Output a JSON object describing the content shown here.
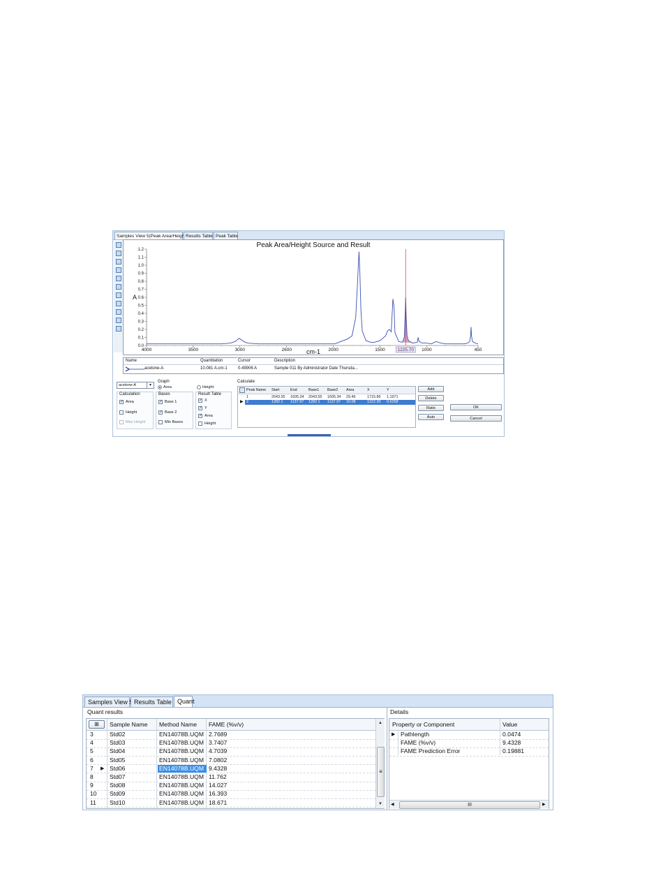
{
  "shot1": {
    "tabs": [
      {
        "label": "Samples View 5(Peak Area/Height)",
        "active": true
      },
      {
        "label": "Results Table",
        "active": false
      },
      {
        "label": "Peak Table",
        "active": false
      }
    ],
    "chart_data": {
      "type": "line",
      "title": "Peak Area/Height Source and Result",
      "xlabel": "cm-1",
      "ylabel": "A",
      "x_reversed": true,
      "xlim": [
        4000,
        450
      ],
      "ylim": [
        0,
        1.2
      ],
      "x_tick_labels": [
        "4000",
        "3500",
        "3000",
        "2600",
        "2000",
        "1500",
        "1000",
        "450"
      ],
      "x_ticks": [
        4000,
        3500,
        3000,
        2500,
        2000,
        1500,
        1000,
        450
      ],
      "y_ticks": [
        "0.0",
        "0.1",
        "0.2",
        "0.3",
        "0.4",
        "0.5",
        "0.6",
        "0.7",
        "0.8",
        "0.9",
        "1.0",
        "1.1",
        "1.2"
      ],
      "cursor_label": "1225.70",
      "cursor_x": 1225.7,
      "line_color": "#3a4fb3",
      "cursor_color": "#d62a2a",
      "fill_color": "#d9a5c2",
      "series": [
        {
          "x": [
            4000,
            3800,
            3600,
            3400,
            3200,
            3100,
            3050,
            3010,
            2960,
            2920,
            2800,
            2600,
            2400,
            2200,
            2100,
            2050,
            2020,
            1990,
            1960,
            1920,
            1850,
            1800,
            1760,
            1740,
            1725,
            1715,
            1705,
            1690,
            1650,
            1600,
            1560,
            1500,
            1440,
            1420,
            1400,
            1380,
            1362,
            1350,
            1340,
            1300,
            1260,
            1240,
            1232,
            1225,
            1220,
            1210,
            1195,
            1150,
            1100,
            1092,
            1080,
            1050,
            1000,
            950,
            900,
            850,
            800,
            720,
            640,
            600,
            560,
            540,
            530,
            525,
            520,
            510,
            480,
            450
          ],
          "y": [
            0.02,
            0.02,
            0.02,
            0.02,
            0.02,
            0.03,
            0.05,
            0.09,
            0.05,
            0.03,
            0.02,
            0.02,
            0.02,
            0.02,
            0.02,
            0.02,
            0.02,
            0.02,
            0.03,
            0.05,
            0.08,
            0.12,
            0.35,
            0.8,
            1.17,
            0.9,
            0.45,
            0.18,
            0.06,
            0.04,
            0.04,
            0.06,
            0.12,
            0.18,
            0.2,
            0.17,
            0.58,
            0.48,
            0.16,
            0.05,
            0.04,
            0.1,
            0.35,
            0.6,
            0.35,
            0.12,
            0.06,
            0.03,
            0.04,
            0.1,
            0.05,
            0.03,
            0.03,
            0.02,
            0.05,
            0.03,
            0.02,
            0.02,
            0.02,
            0.02,
            0.03,
            0.05,
            0.12,
            0.23,
            0.12,
            0.05,
            0.03,
            0.02
          ]
        }
      ]
    },
    "legend": {
      "headers": [
        "Name",
        "Quantitation",
        "Cursor",
        "Description"
      ],
      "row": {
        "name": "acetone-A",
        "quantitation": "10.081 A.cm-1",
        "cursor": "0.49906 A",
        "description": "Sample 011 By Administrator Date Thursda..."
      }
    },
    "controls": {
      "component_select": "acetone-A",
      "graph_label": "Graph",
      "graph_area": "Area",
      "graph_height": "Height",
      "calculation_label": "Calculation",
      "calc_area": "Area",
      "calc_height": "Height",
      "calc_max_height": "Max Height",
      "bases_label": "Bases",
      "base1": "Base 1",
      "base2": "Base 2",
      "min_bases": "Min Bases",
      "result_table_label": "Result Table",
      "rt_x": "X",
      "rt_y": "Y",
      "rt_area": "Area",
      "rt_height": "Height"
    },
    "calculate": {
      "label": "Calculate",
      "headers": [
        "Peak Name",
        "Start",
        "End",
        "Base1",
        "Base2",
        "Area",
        "X",
        "Y"
      ],
      "rows": [
        [
          "1",
          "2043.55",
          "1605.34",
          "2043.55",
          "1605.34",
          "29.46",
          "1715.86",
          "1.1971"
        ],
        [
          "2",
          "1282.1",
          "1137.97",
          "1282.1",
          "1137.97",
          "10.08",
          "1222.30",
          "0.6258"
        ]
      ],
      "selected_row": 1
    },
    "buttons": {
      "add": "Add",
      "delete": "Delete",
      "ratio": "Ratio",
      "auto": "Auto",
      "ok": "OK",
      "cancel": "Cancel"
    }
  },
  "shot2": {
    "tabs": [
      {
        "label": "Samples View 5",
        "active": false
      },
      {
        "label": "Results Table",
        "active": false
      },
      {
        "label": "Quant",
        "active": true
      }
    ],
    "quant_title": "Quant results",
    "quant_headers": [
      "Sample Name",
      "Method Name",
      "FAME (%v/v)"
    ],
    "quant_rows": [
      {
        "num": "3",
        "sample": "Std02",
        "method": "EN14078B.UQM",
        "fame": "2.7689"
      },
      {
        "num": "4",
        "sample": "Std03",
        "method": "EN14078B.UQM",
        "fame": "3.7407"
      },
      {
        "num": "5",
        "sample": "Std04",
        "method": "EN14078B.UQM",
        "fame": "4.7039"
      },
      {
        "num": "6",
        "sample": "Std05",
        "method": "EN14078B.UQM",
        "fame": "7.0802"
      },
      {
        "num": "7",
        "sample": "Std06",
        "method": "EN14078B.UQM",
        "fame": "9.4328"
      },
      {
        "num": "8",
        "sample": "Std07",
        "method": "EN14078B.UQM",
        "fame": "11.762"
      },
      {
        "num": "9",
        "sample": "Std08",
        "method": "EN14078B.UQM",
        "fame": "14.027"
      },
      {
        "num": "10",
        "sample": "Std09",
        "method": "EN14078B.UQM",
        "fame": "16.393"
      },
      {
        "num": "11",
        "sample": "Std10",
        "method": "EN14078B.UQM",
        "fame": "18.671"
      }
    ],
    "selected_row": 4,
    "details_title": "Details",
    "details_headers": [
      "Property or Component",
      "Value"
    ],
    "details_rows": [
      {
        "prop": "Pathlength",
        "value": "0.0474"
      },
      {
        "prop": "FAME (%v/v)",
        "value": "9.4328"
      },
      {
        "prop": "FAME Prediction Error",
        "value": "0.19881"
      }
    ],
    "scroll_grip": "III",
    "scroll_grip_v": "≡"
  }
}
